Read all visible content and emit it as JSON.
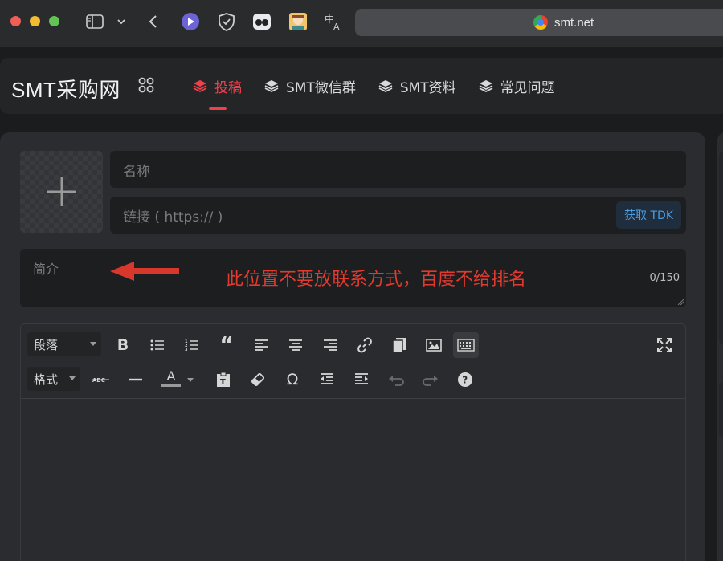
{
  "browser": {
    "url": "smt.net"
  },
  "site": {
    "logo": "SMT采购网",
    "nav": [
      {
        "label": "投稿",
        "active": true
      },
      {
        "label": "SMT微信群",
        "active": false
      },
      {
        "label": "SMT资料",
        "active": false
      },
      {
        "label": "常见问题",
        "active": false
      }
    ]
  },
  "form": {
    "name_placeholder": "名称",
    "link_placeholder": "链接 ( https:// )",
    "tdk_button": "获取 TDK",
    "summary_placeholder": "简介",
    "summary_count": "0/150",
    "annotation": "此位置不要放联系方式，百度不给排名"
  },
  "editor": {
    "paragraph_select": "段落",
    "format_select": "格式",
    "text_color_label": "A"
  },
  "colors": {
    "accent": "#f1404b",
    "annotation": "#e23a2e",
    "tdk": "#4a9de0"
  }
}
